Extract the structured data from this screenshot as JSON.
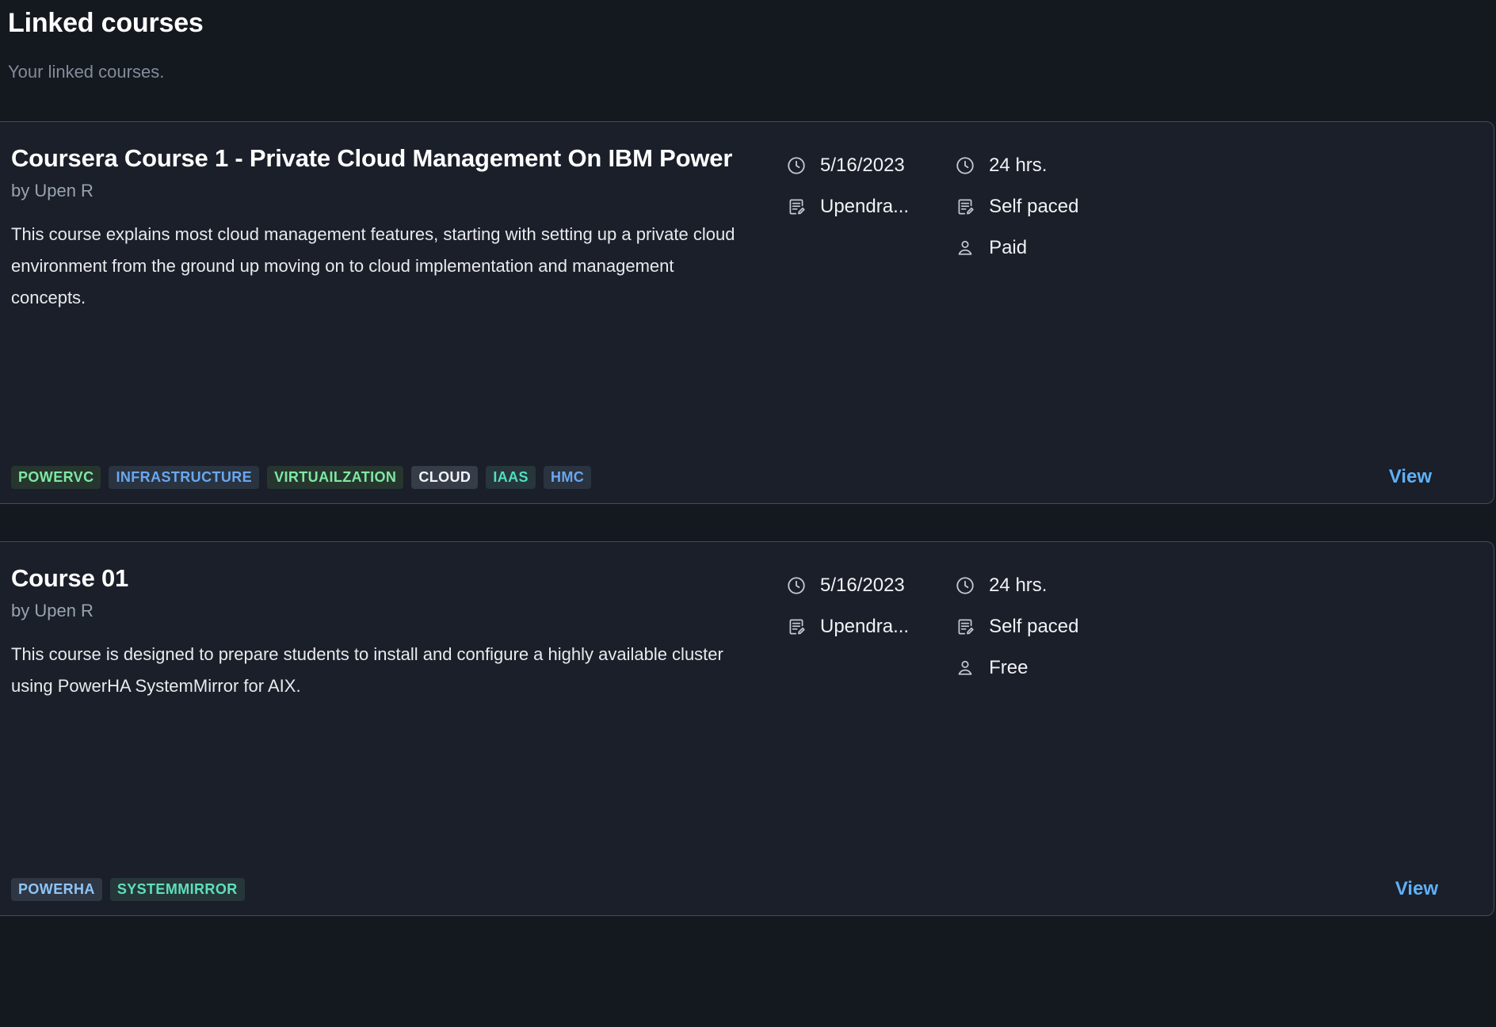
{
  "header": {
    "title": "Linked courses",
    "subtitle": "Your linked courses."
  },
  "colors": {
    "page_background": "#14181f",
    "card_background": "#1a1f29",
    "card_border": "#464c57",
    "title_text": "#ffffff",
    "subtitle_text": "#848c99",
    "body_text": "#e8eaee",
    "author_text": "#9aa3b0",
    "link_accent": "#5fb0f7",
    "icon": "#c3c8d1"
  },
  "courses": [
    {
      "title": "Coursera Course 1 - Private Cloud Management On IBM Power",
      "author": "by Upen R",
      "description": "This course explains most cloud management features, starting with setting up a private cloud environment from the ground up moving on to cloud implementation and management concepts.",
      "meta": {
        "date": {
          "icon": "clock-icon",
          "value": "5/16/2023"
        },
        "creator": {
          "icon": "note-edit-icon",
          "value": "Upendra..."
        },
        "duration": {
          "icon": "clock-icon",
          "value": "24 hrs."
        },
        "pace": {
          "icon": "note-edit-icon",
          "value": "Self paced"
        },
        "price": {
          "icon": "person-icon",
          "value": "Paid"
        }
      },
      "tags": [
        {
          "label": "POWERVC",
          "color": "#7ee8a2",
          "background": "#26362f"
        },
        {
          "label": "INFRASTRUCTURE",
          "color": "#69a7ef",
          "background": "#2a3340"
        },
        {
          "label": "VIRTUAILZATION",
          "color": "#7ee8a2",
          "background": "#26362f"
        },
        {
          "label": "CLOUD",
          "color": "#f2f4f8",
          "background": "#363c48"
        },
        {
          "label": "IAAS",
          "color": "#52ddc0",
          "background": "#26363b"
        },
        {
          "label": "HMC",
          "color": "#69a7ef",
          "background": "#2a3340"
        }
      ],
      "view_label": "View"
    },
    {
      "title": "Course 01",
      "author": "by Upen R",
      "description": "This course is designed to prepare students to install and configure a highly available cluster using PowerHA SystemMirror for AIX.",
      "meta": {
        "date": {
          "icon": "clock-icon",
          "value": "5/16/2023"
        },
        "creator": {
          "icon": "note-edit-icon",
          "value": "Upendra..."
        },
        "duration": {
          "icon": "clock-icon",
          "value": "24 hrs."
        },
        "pace": {
          "icon": "note-edit-icon",
          "value": "Self paced"
        },
        "price": {
          "icon": "person-icon",
          "value": "Free"
        }
      },
      "tags": [
        {
          "label": "POWERHA",
          "color": "#8ec5f7",
          "background": "#2f3744"
        },
        {
          "label": "SYSTEMMIRROR",
          "color": "#5fe0b8",
          "background": "#26373a"
        }
      ],
      "view_label": "View"
    }
  ]
}
